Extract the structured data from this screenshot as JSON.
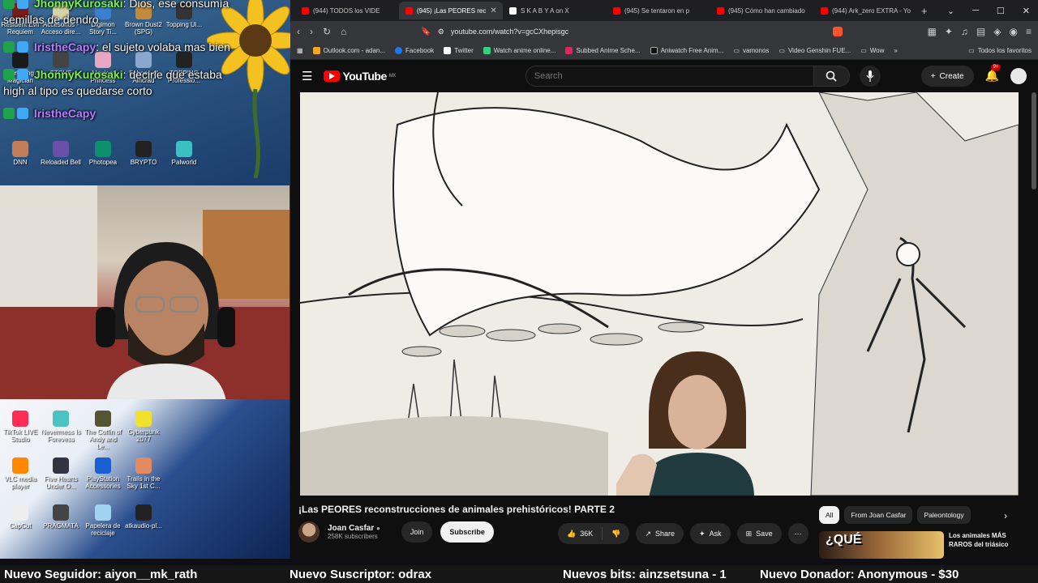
{
  "stream_overlay": {
    "chat": [
      {
        "user": "JhonnyKurosaki",
        "user_color": "#7cf04c",
        "message": ": Dios, ese consumía semillas de dendro"
      },
      {
        "user": "IristheCapy",
        "user_color": "#b77cff",
        "message": ": el sujeto volaba mas bien"
      },
      {
        "user": "JhonnyKurosaki",
        "user_color": "#7cf04c",
        "message": ": decirle que estaba high al tipo es quedarse corto"
      },
      {
        "user": "IristheCapy",
        "user_color": "#b77cff",
        "message": ""
      }
    ],
    "desktop_icons_top": [
      "Resident Evil Requiem",
      "Accesorios - Acceso dire...",
      "Digimon Story Ti...",
      "Brown Dust2 (SPG)",
      "Topping Ui...",
      "Samsung Magician",
      "STOVE",
      "Magical Princess",
      "Echoes of Aincrad",
      "TOPPING Professio...",
      "DNN",
      "Reloaded Bell",
      "Photopea",
      "BRYPTO",
      "Palworld"
    ],
    "desktop_icons_bottom": [
      "TikTok LIVE Studio",
      "Nevermess Is Forevess",
      "The Coffin of Andy and Le...",
      "Cyberpunk 2077",
      "VLC media player",
      "Five Hearts Under O...",
      "PlayStation Accessories",
      "Trails in the Sky 1st C...",
      "CapCut",
      "PRAGMATA",
      "Papelera de reciclaje",
      "atkaudio-pl..."
    ]
  },
  "browser": {
    "tabs": [
      {
        "label": "(944) TODOS los VIDE",
        "color": "#ff0000",
        "active": false
      },
      {
        "label": "(945) ¡Las PEORES rec",
        "color": "#ff0000",
        "active": true
      },
      {
        "label": "S K A B Y A on X",
        "color": "#ffffff",
        "active": false
      },
      {
        "label": "(945) Se tentaron en p",
        "color": "#ff0000",
        "active": false
      },
      {
        "label": "(945) Cómo han cambiado",
        "color": "#ff0000",
        "active": false
      },
      {
        "label": "(944) Ark_zero EXTRA - Yo",
        "color": "#ff0000",
        "active": false
      }
    ],
    "url": "youtube.com/watch?v=gcCXhepisgc",
    "bookmarks": [
      "Outlook.com - adan...",
      "Facebook",
      "Twitter",
      "Watch anime online...",
      "Subbed Anime Sche...",
      "Aniwatch Free Anim...",
      "vamonos",
      "Video Genshin FUE...",
      "Wow"
    ],
    "bookmarks_right": "Todos los favoritos"
  },
  "youtube": {
    "logo_text": "YouTube",
    "region": "MX",
    "search_placeholder": "Search",
    "create_label": "Create",
    "notif_count": "9+",
    "video_title": "¡Las PEORES reconstrucciones de animales prehistóricos! PARTE 2",
    "channel_name": "Joan Casfar",
    "channel_subs": "258K subscribers",
    "join_label": "Join",
    "subscribe_label": "Subscribe",
    "like_count": "36K",
    "share_label": "Share",
    "ask_label": "Ask",
    "save_label": "Save",
    "chips": [
      "All",
      "From Joan Casfar",
      "Paleontology"
    ],
    "rec_thumb_text": "¿QUÉ",
    "rec_title": "Los animales MÁS RAROS del triásico"
  },
  "ticker": {
    "follower": "Nuevo Seguidor: aiyon__mk_rath",
    "subscriber": "Nuevo Suscriptor: odrax",
    "bits": "Nuevos bits: ainzsetsuna - 1",
    "donor": "Nuevo Donador: Anonymous - $30"
  }
}
